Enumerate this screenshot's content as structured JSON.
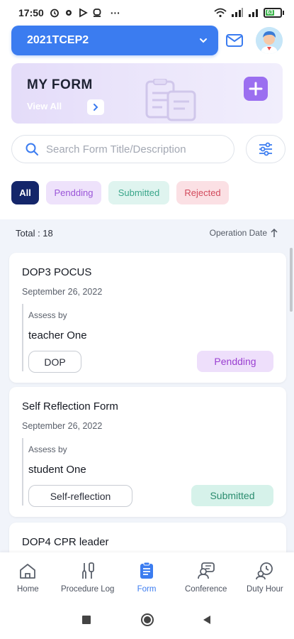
{
  "status_bar": {
    "time": "17:50",
    "battery": "63"
  },
  "header": {
    "course": "2021TCEP2"
  },
  "my_form": {
    "title": "MY FORM",
    "view_all": "View All"
  },
  "search": {
    "placeholder": "Search Form Title/Description"
  },
  "filters": {
    "all": "All",
    "pending": "Pendding",
    "submitted": "Submitted",
    "rejected": "Rejected"
  },
  "list": {
    "total_label": "Total : 18",
    "sort_label": "Operation Date",
    "assess_label": "Assess by",
    "cards": [
      {
        "title": "DOP3 POCUS",
        "date": "September 26, 2022",
        "assessor": "teacher One",
        "type": "DOP",
        "status": "Pendding"
      },
      {
        "title": "Self Reflection Form",
        "date": "September 26, 2022",
        "assessor": "student One",
        "type": "Self-reflection",
        "status": "Submitted"
      },
      {
        "title": "DOP4 CPR leader"
      }
    ]
  },
  "nav": {
    "items": [
      {
        "label": "Home",
        "icon": "home-icon"
      },
      {
        "label": "Procedure Log",
        "icon": "procedure-log-icon"
      },
      {
        "label": "Form",
        "icon": "form-icon"
      },
      {
        "label": "Conference",
        "icon": "conference-icon"
      },
      {
        "label": "Duty Hour",
        "icon": "duty-hour-icon"
      }
    ],
    "active": "Form"
  },
  "colors": {
    "primary": "#3b7cf0",
    "all_chip": "#14266a",
    "pending": "#9a55d8",
    "submitted": "#3aa68a",
    "rejected": "#d24a5c",
    "plus_button": "#9b6ff0"
  }
}
